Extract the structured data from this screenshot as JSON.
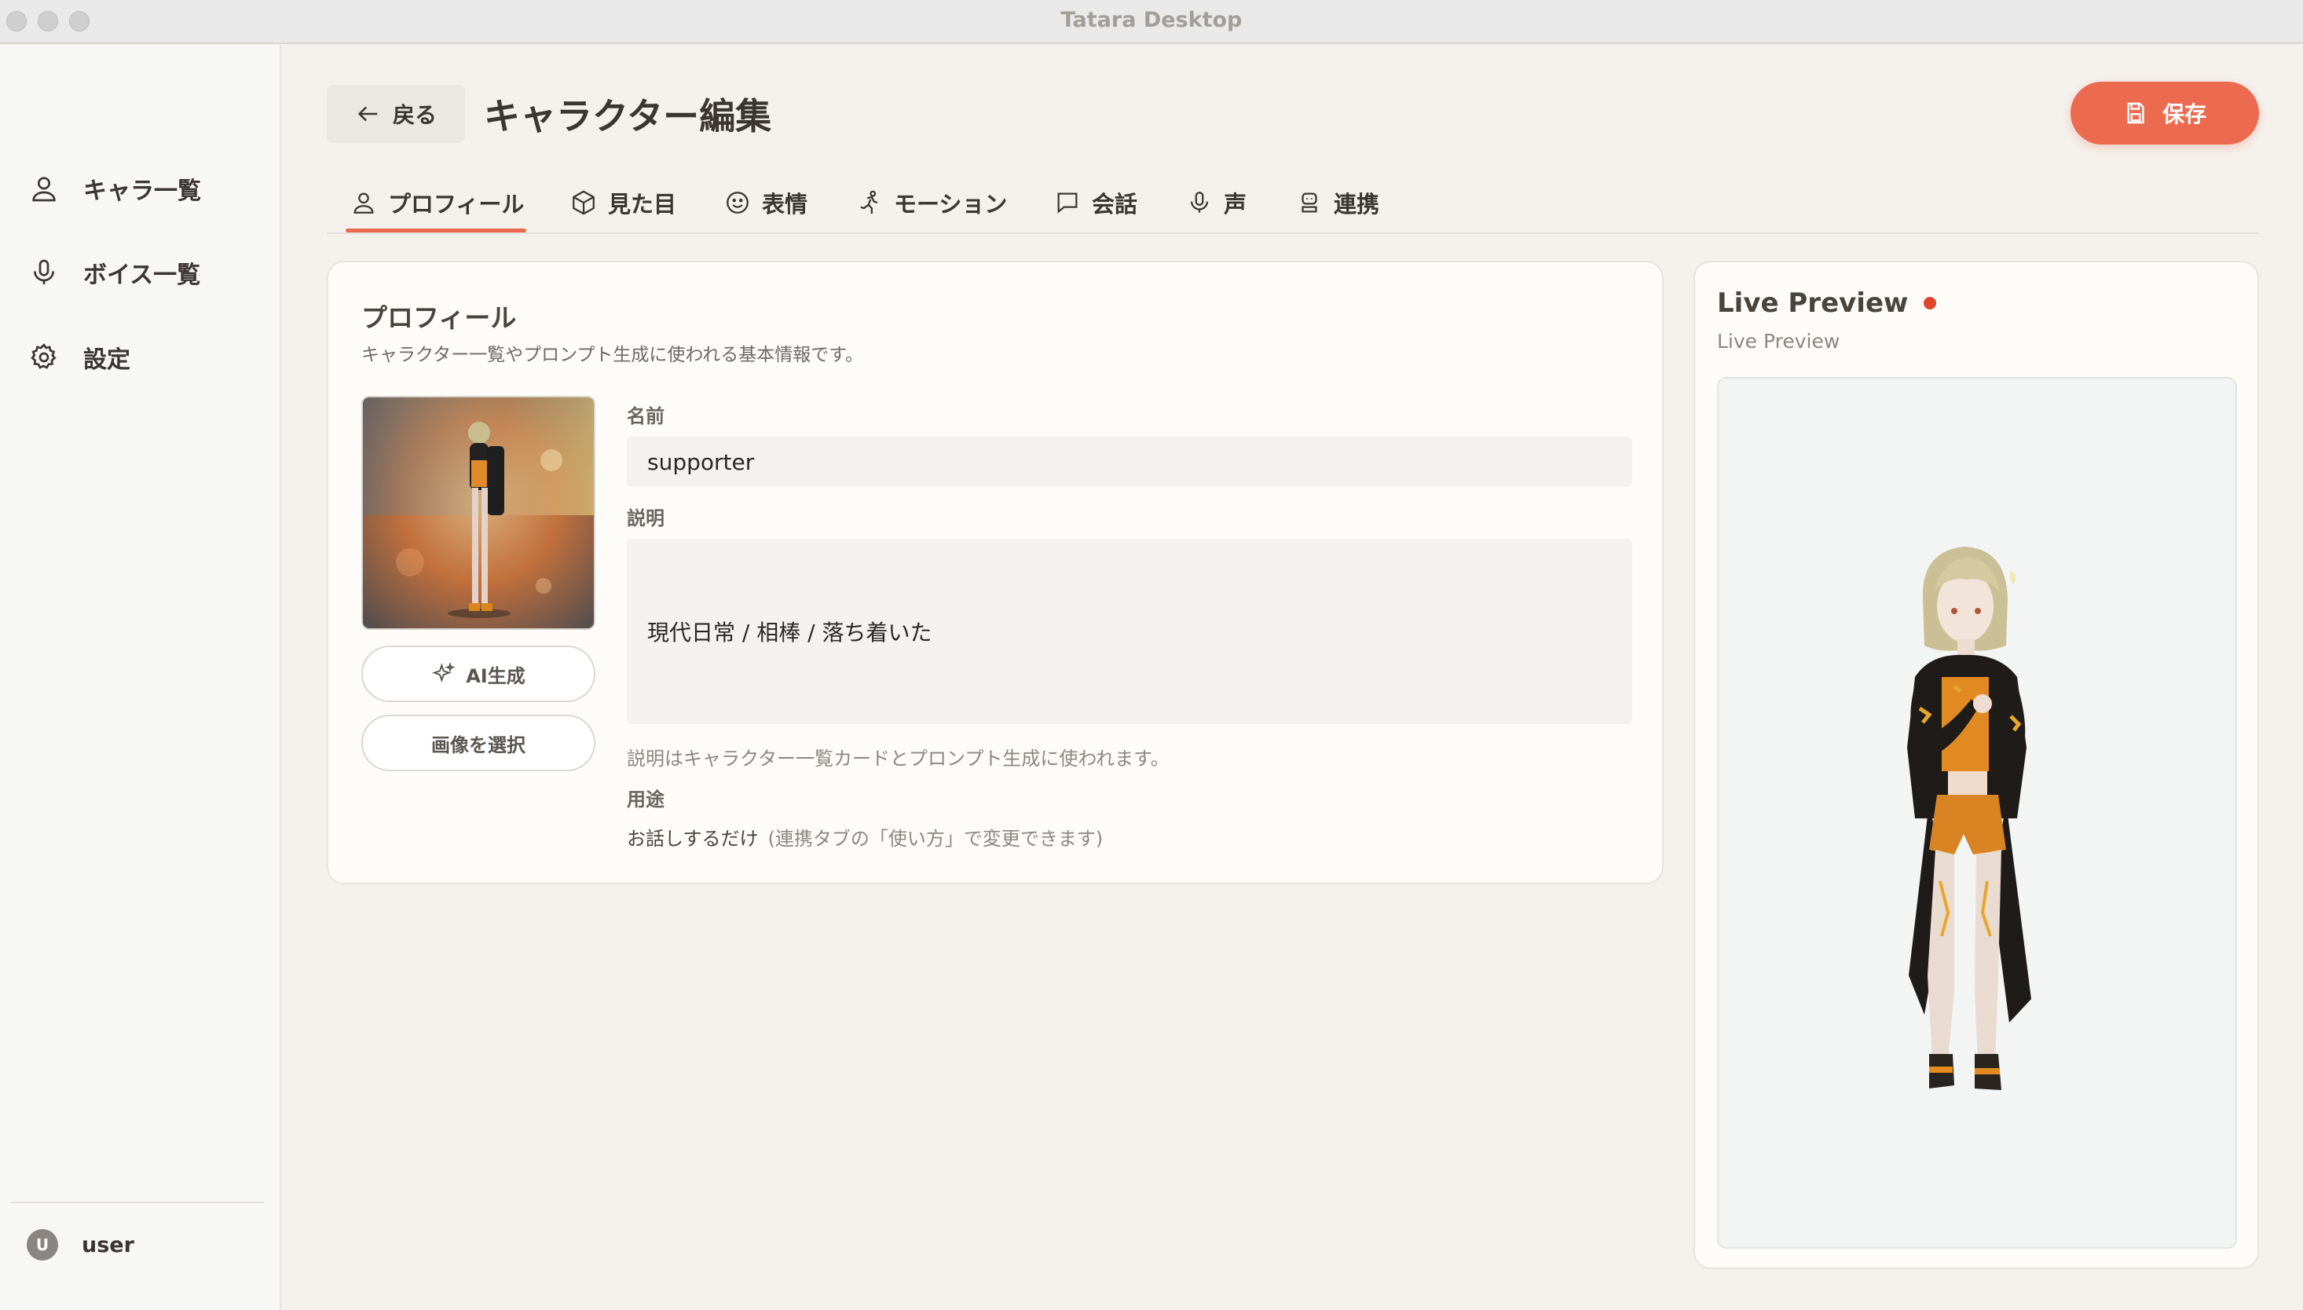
{
  "window": {
    "title": "Tatara Desktop"
  },
  "sidebar": {
    "items": [
      {
        "label": "キャラ一覧",
        "icon": "user-icon"
      },
      {
        "label": "ボイス一覧",
        "icon": "microphone-icon"
      },
      {
        "label": "設定",
        "icon": "gear-icon"
      }
    ],
    "user": {
      "initial": "U",
      "name": "user"
    }
  },
  "header": {
    "back_label": "戻る",
    "title": "キャラクター編集",
    "save_label": "保存"
  },
  "tabs": [
    {
      "label": "プロフィール",
      "icon": "user-icon",
      "active": true
    },
    {
      "label": "見た目",
      "icon": "cube-icon"
    },
    {
      "label": "表情",
      "icon": "smile-icon"
    },
    {
      "label": "モーション",
      "icon": "running-icon"
    },
    {
      "label": "会話",
      "icon": "chat-icon"
    },
    {
      "label": "声",
      "icon": "microphone-icon"
    },
    {
      "label": "連携",
      "icon": "robot-icon"
    }
  ],
  "profile": {
    "title": "プロフィール",
    "subtitle": "キャラクター一覧やプロンプト生成に使われる基本情報です。",
    "ai_button": "AI生成",
    "select_image_button": "画像を選択",
    "name_label": "名前",
    "name_value": "supporter",
    "desc_label": "説明",
    "desc_value": "現代日常 / 相棒 / 落ち着いた",
    "desc_hint": "説明はキャラクター一覧カードとプロンプト生成に使われます。",
    "usage_label": "用途",
    "usage_value": "お話しするだけ",
    "usage_sub": "(連携タブの「使い方」で変更できます)"
  },
  "preview": {
    "title": "Live Preview",
    "subtitle": "Live Preview"
  },
  "colors": {
    "accent": "#ec6b50",
    "live_dot": "#e0452d",
    "background": "#f4f1ec"
  }
}
